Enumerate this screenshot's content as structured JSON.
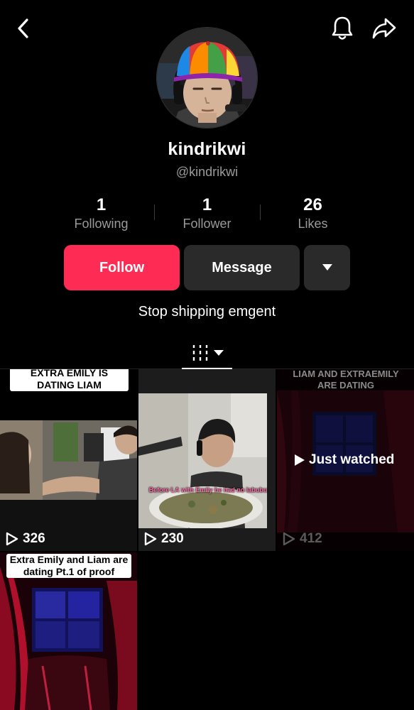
{
  "header": {
    "back_icon": "chevron-left-icon",
    "notifications_icon": "bell-icon",
    "share_icon": "share-arrow-icon"
  },
  "profile": {
    "display_name": "kindrikwi",
    "handle": "@kindrikwi",
    "bio": "Stop shipping emgent"
  },
  "stats": [
    {
      "value": "1",
      "label": "Following"
    },
    {
      "value": "1",
      "label": "Follower"
    },
    {
      "value": "26",
      "label": "Likes"
    }
  ],
  "actions": {
    "follow_label": "Follow",
    "message_label": "Message",
    "more_icon": "caret-down-icon"
  },
  "tabs": {
    "videos_icon": "videos-grid-icon",
    "sort_icon": "caret-down-icon"
  },
  "videos": [
    {
      "caption": "EXTRA EMILY IS DATING LIAM",
      "views": "326",
      "overlay_text": ""
    },
    {
      "caption": "",
      "views": "230",
      "overlay_text": "Before LA with Emily he had no labubu"
    },
    {
      "caption": "LIAM AND EXTRAEMILY ARE DATING",
      "views": "412",
      "status": "Just watched"
    },
    {
      "caption": "Extra Emily and Liam are dating Pt.1 of proof",
      "views": ""
    }
  ],
  "colors": {
    "background": "#000000",
    "accent": "#fe2c55",
    "secondary_button": "#2a2a2a",
    "muted_text": "#9a9a9a"
  }
}
